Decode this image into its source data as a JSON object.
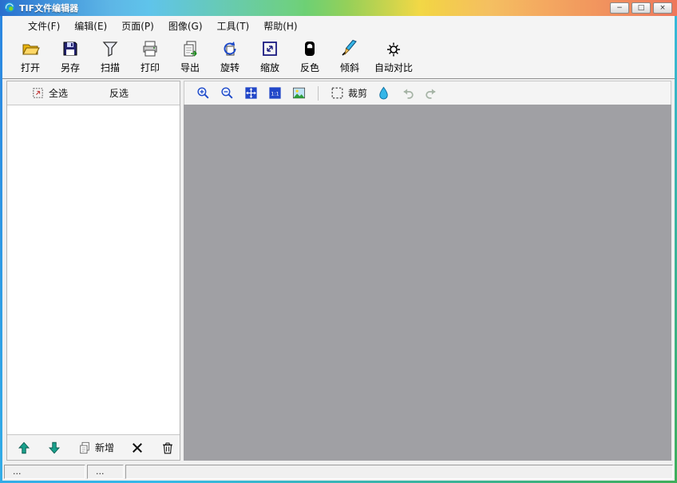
{
  "window": {
    "title": "TIF文件编辑器",
    "minimize_glyph": "−",
    "maximize_glyph": "□",
    "close_glyph": "×"
  },
  "menu": {
    "items": [
      {
        "label": "文件(F)"
      },
      {
        "label": "编辑(E)"
      },
      {
        "label": "页面(P)"
      },
      {
        "label": "图像(G)"
      },
      {
        "label": "工具(T)"
      },
      {
        "label": "帮助(H)"
      }
    ]
  },
  "toolbar": {
    "items": [
      {
        "label": "打开",
        "icon": "open-folder-icon"
      },
      {
        "label": "另存",
        "icon": "save-icon"
      },
      {
        "label": "扫描",
        "icon": "scan-icon"
      },
      {
        "label": "打印",
        "icon": "print-icon"
      },
      {
        "label": "导出",
        "icon": "export-icon"
      },
      {
        "label": "旋转",
        "icon": "rotate-icon"
      },
      {
        "label": "缩放",
        "icon": "resize-icon"
      },
      {
        "label": "反色",
        "icon": "invert-icon"
      },
      {
        "label": "倾斜",
        "icon": "skew-icon"
      },
      {
        "label": "自动对比",
        "icon": "auto-contrast-icon"
      }
    ]
  },
  "left_panel": {
    "select_all_label": "全选",
    "invert_label": "反选",
    "add_label": "新增"
  },
  "canvas_toolbar": {
    "crop_label": "裁剪"
  },
  "statusbar": {
    "cells": [
      "...",
      "...",
      ""
    ]
  },
  "colors": {
    "canvas_bg": "#a0a0a4",
    "chrome_bg": "#f4f4f4",
    "titlebar_gradient": [
      "#1e68cc",
      "#2ab0e4",
      "#40c24a",
      "#f0d020",
      "#f08c1c",
      "#e63c14"
    ]
  }
}
